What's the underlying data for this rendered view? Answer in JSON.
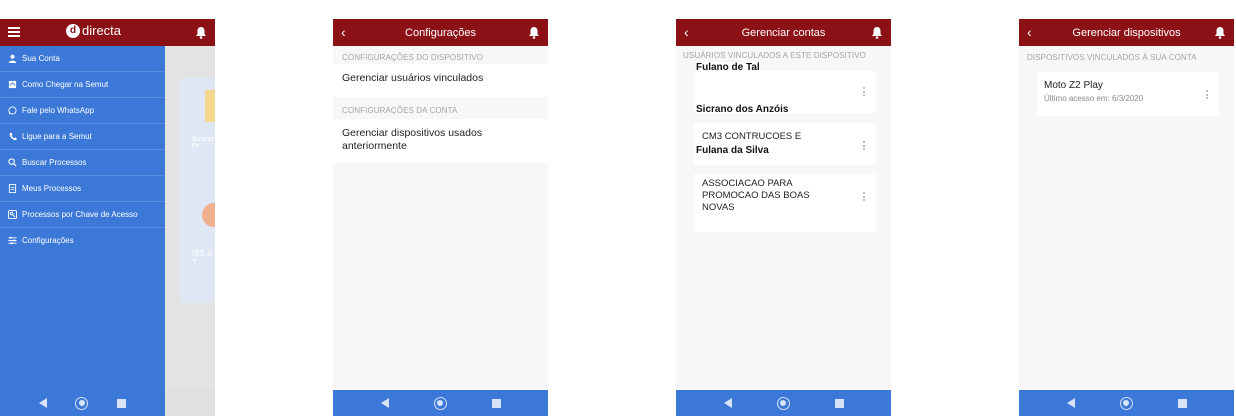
{
  "screens": {
    "drawer": {
      "logo_text": "directa",
      "logo_letter": "d",
      "items": [
        {
          "label": "Sua Conta",
          "icon": "person-icon"
        },
        {
          "label": "Como Chegar na Semut",
          "icon": "map-icon"
        },
        {
          "label": "Fale pelo WhatsApp",
          "icon": "whatsapp-icon"
        },
        {
          "label": "Ligue para a Semut",
          "icon": "phone-icon"
        },
        {
          "label": "Buscar Processos",
          "icon": "search-icon"
        },
        {
          "label": "Meus Processos",
          "icon": "document-icon"
        },
        {
          "label": "Processos por Chave de Acesso",
          "icon": "key-icon"
        },
        {
          "label": "Configurações",
          "icon": "sliders-icon"
        }
      ],
      "bg_cards": {
        "card1_text": "Buscar Pr",
        "card2_text": "ISS e T"
      }
    },
    "config": {
      "title": "Configurações",
      "section1": "CONFIGURAÇÕES DO DISPOSITIVO",
      "item1": "Gerenciar usuários vinculados",
      "section2": "CONFIGURAÇÕES DA CONTA",
      "item2_line1": "Gerenciar dispositivos usados",
      "item2_line2": "anteriormente"
    },
    "accounts": {
      "title": "Gerenciar contas",
      "section": "USUÁRIOS VINCULADOS A ESTE DISPOSITIVO",
      "labels": [
        "Fulano de Tal",
        "Sicrano dos Anzóis",
        "Fulana da Silva"
      ],
      "company1": "CM3 CONTRUCOES E",
      "company2_line1": "ASSOCIACAO PARA",
      "company2_line2": "PROMOCAO DAS BOAS",
      "company2_line3": "NOVAS"
    },
    "devices": {
      "title": "Gerenciar dispositivos",
      "section": "DISPOSITIVOS VINCULADOS À SUA CONTA",
      "device_name": "Moto Z2 Play",
      "last_access": "Último acesso em: 6/3/2020"
    }
  },
  "colors": {
    "appbar": "#8b1116",
    "drawer": "#3b78d8",
    "navbar": "#3b78d8"
  }
}
